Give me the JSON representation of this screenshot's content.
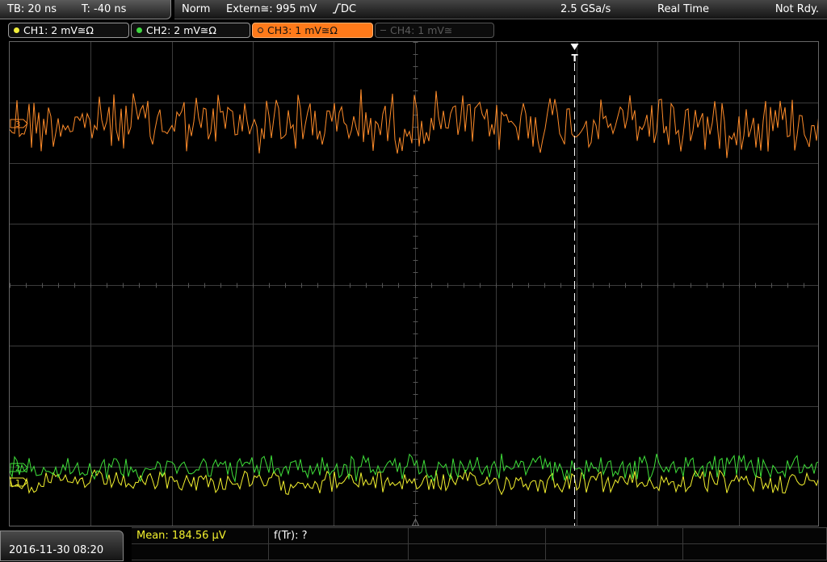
{
  "status": {
    "timebase": "TB: 20 ns",
    "trigger_offset": "T: -40 ns",
    "mode": "Norm",
    "trigger_source": "Extern≅: 995 mV",
    "trigger_coupling": "DC",
    "sample_rate": "2.5 GSa/s",
    "acq_mode": "Real Time",
    "state": "Not Rdy."
  },
  "channels": [
    {
      "label": "CH1: 2 mV≅Ω",
      "color": "#f2ef3a",
      "active": true
    },
    {
      "label": "CH2: 2 mV≅Ω",
      "color": "#3fd640",
      "active": true
    },
    {
      "label": "CH3: 1 mV≅Ω",
      "color": "#ff7a1a",
      "active": true,
      "selected": true
    },
    {
      "label": "CH4: 1 mV≅",
      "color": "#666666",
      "active": false
    }
  ],
  "markers": {
    "trigger_position": "T",
    "ch3_marker": "3",
    "ch2_marker": "2",
    "ch1_marker": "1"
  },
  "bottom": {
    "datetime": "2016-11-30 08:20",
    "meas1": "Mean: 184.56 µV",
    "meas2": "f(Tr): ?"
  },
  "colors": {
    "ch3_trace": "#ff8c2a",
    "ch2_trace": "#3fe03a",
    "ch1_trace": "#f4f22e",
    "grid": "#3c3c3c"
  }
}
